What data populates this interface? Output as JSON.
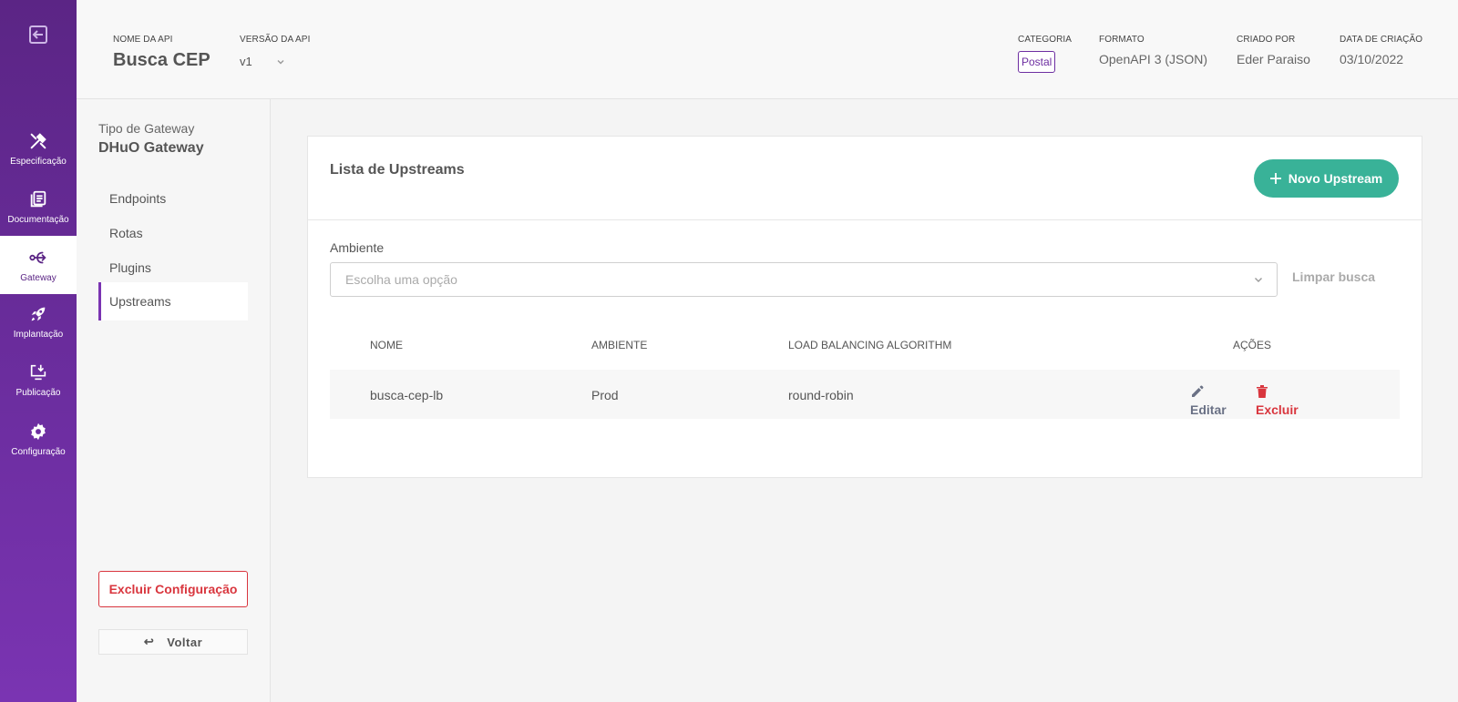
{
  "header": {
    "api_name_label": "NOME DA API",
    "api_name": "Busca CEP",
    "version_label": "VERSÃO DA API",
    "version": "v1",
    "category_label": "CATEGORIA",
    "category": "Postal",
    "format_label": "FORMATO",
    "format": "OpenAPI 3 (JSON)",
    "created_by_label": "CRIADO POR",
    "created_by": "Eder Paraiso",
    "created_at_label": "DATA DE CRIAÇÃO",
    "created_at": "03/10/2022"
  },
  "leftnav": {
    "items": [
      {
        "label": "Especificação",
        "icon": "tools-icon"
      },
      {
        "label": "Documentação",
        "icon": "book-icon"
      },
      {
        "label": "Gateway",
        "icon": "gateway-icon"
      },
      {
        "label": "Implantação",
        "icon": "rocket-icon"
      },
      {
        "label": "Publicação",
        "icon": "monitor-download-icon"
      },
      {
        "label": "Configuração",
        "icon": "gear-icon"
      }
    ],
    "active": "Gateway"
  },
  "subside": {
    "gateway_type_label": "Tipo de Gateway",
    "gateway_type": "DHuO Gateway",
    "menu": [
      "Endpoints",
      "Rotas",
      "Plugins",
      "Upstreams"
    ],
    "active": "Upstreams",
    "delete_config_label": "Excluir Configuração",
    "back_label": "Voltar"
  },
  "main": {
    "title": "Lista de Upstreams",
    "new_button": "Novo Upstream",
    "env_label": "Ambiente",
    "env_placeholder": "Escolha uma opção",
    "clear_label": "Limpar busca",
    "columns": [
      "NOME",
      "AMBIENTE",
      "LOAD BALANCING ALGORITHM",
      "AÇÕES"
    ],
    "rows": [
      {
        "name": "busca-cep-lb",
        "env": "Prod",
        "algorithm": "round-robin"
      }
    ],
    "edit_label": "Editar",
    "delete_label": "Excluir"
  },
  "colors": {
    "sidebar": "#6d2ea1",
    "accent": "#39b298",
    "danger": "#d9363e"
  }
}
